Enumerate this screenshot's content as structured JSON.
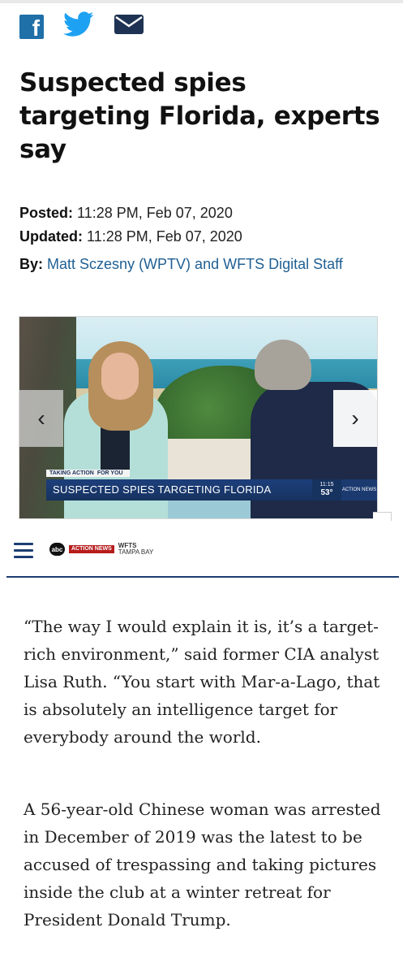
{
  "share": {
    "facebook_icon": "facebook-icon",
    "twitter_icon": "twitter-icon",
    "email_icon": "email-icon"
  },
  "article": {
    "headline": "Suspected spies targeting Florida, experts say",
    "posted_label": "Posted:",
    "posted_value": "11:28 PM, Feb 07, 2020",
    "updated_label": "Updated:",
    "updated_value": "11:28 PM, Feb 07, 2020",
    "by_label": "By:",
    "authors": "Matt Sczesny (WPTV) and WFTS Digital Staff"
  },
  "video": {
    "tag_left": "TAKING ACTION",
    "tag_right": "FOR YOU",
    "lower_third": "SUSPECTED SPIES TARGETING FLORIDA",
    "clock_time": "11:15",
    "clock_temp": "53°",
    "channel_logo": "ACTION NEWS",
    "prev_label": "‹",
    "next_label": "›"
  },
  "nav": {
    "menu_icon": "hamburger-menu-icon",
    "logo_abc": "abc",
    "logo_action": "ACTION NEWS",
    "logo_station": "WFTS",
    "logo_market": "TAMPA BAY"
  },
  "paragraphs": [
    "“The way I would explain it is, it’s a target-rich environment,” said former CIA analyst Lisa Ruth. “You start with Mar-a-Lago, that is absolutely an intelligence target for everybody around the world.",
    "A 56-year-old Chinese woman was arrested in December of 2019 was the latest to be accused of trespassing and taking pictures inside the club at a winter retreat for President Donald Trump."
  ],
  "colors": {
    "facebook": "#1f6fa8",
    "twitter": "#1da1f2",
    "email": "#1e3353",
    "author_link": "#1f5f93",
    "nav_accent": "#1c3d72"
  }
}
